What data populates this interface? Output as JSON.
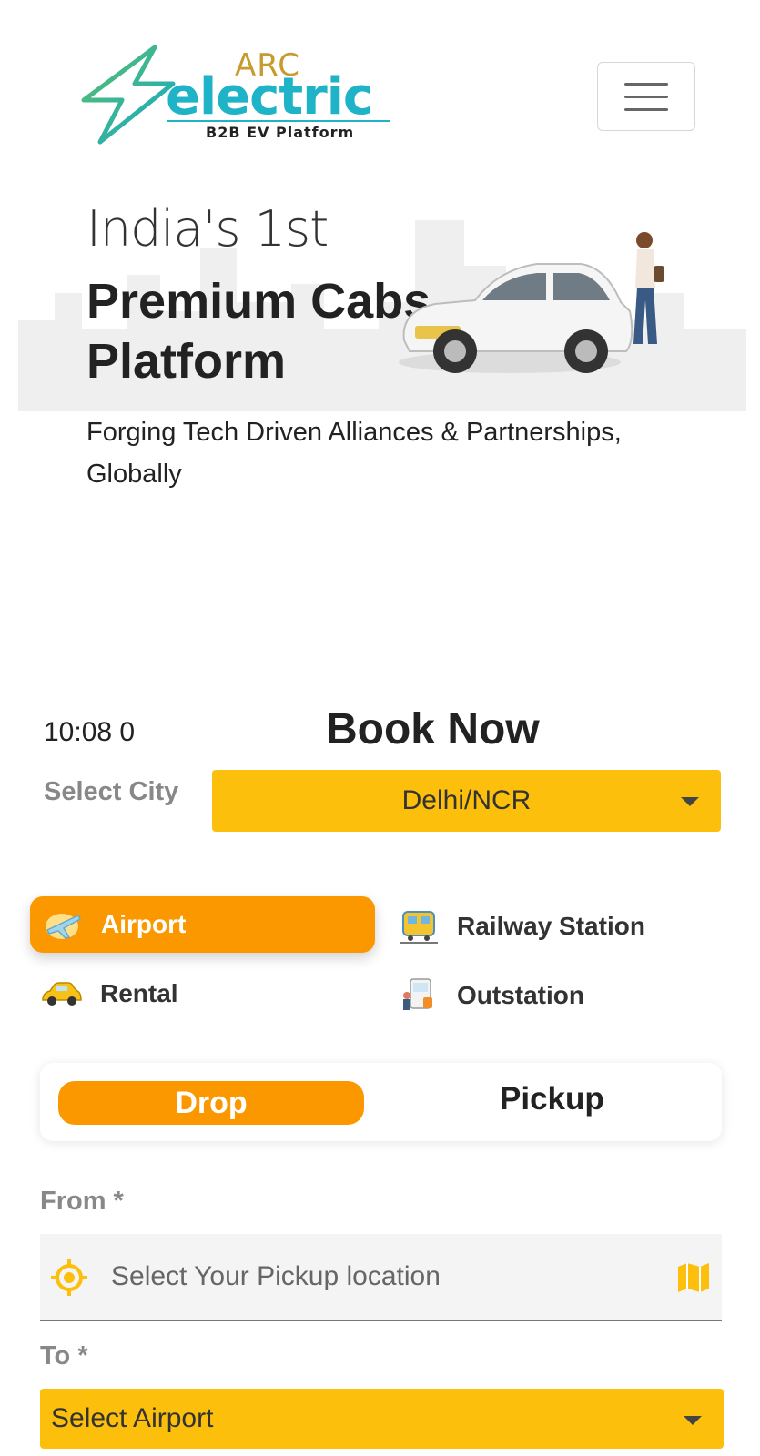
{
  "header": {
    "logo": {
      "top_text": "ARC",
      "main_text": "electric",
      "tagline": "B2B EV Platform"
    },
    "menu_icon": "hamburger-menu-icon"
  },
  "hero": {
    "pre_title": "India's 1st",
    "title": "Premium Cabs Platform",
    "subtitle": "Forging Tech Driven Alliances & Partnerships, Globally"
  },
  "booking": {
    "time": "10:08 0",
    "title": "Book Now",
    "city_label": "Select City",
    "city_value": "Delhi/NCR",
    "trip_types": [
      {
        "label": "Airport",
        "icon": "airplane-icon",
        "active": true
      },
      {
        "label": "Railway Station",
        "icon": "train-icon",
        "active": false
      },
      {
        "label": "Rental",
        "icon": "taxi-icon",
        "active": false
      },
      {
        "label": "Outstation",
        "icon": "outstation-icon",
        "active": false
      }
    ],
    "direction": {
      "drop": "Drop",
      "pickup": "Pickup",
      "active": "Drop"
    },
    "from_label": "From *",
    "from_placeholder": "Select Your Pickup location",
    "to_label": "To *",
    "to_value": "Select Airport"
  },
  "colors": {
    "accent_orange": "#fb9800",
    "accent_yellow": "#fcbf0c",
    "logo_teal": "#1fb3c8",
    "logo_gold": "#c89b2e"
  }
}
